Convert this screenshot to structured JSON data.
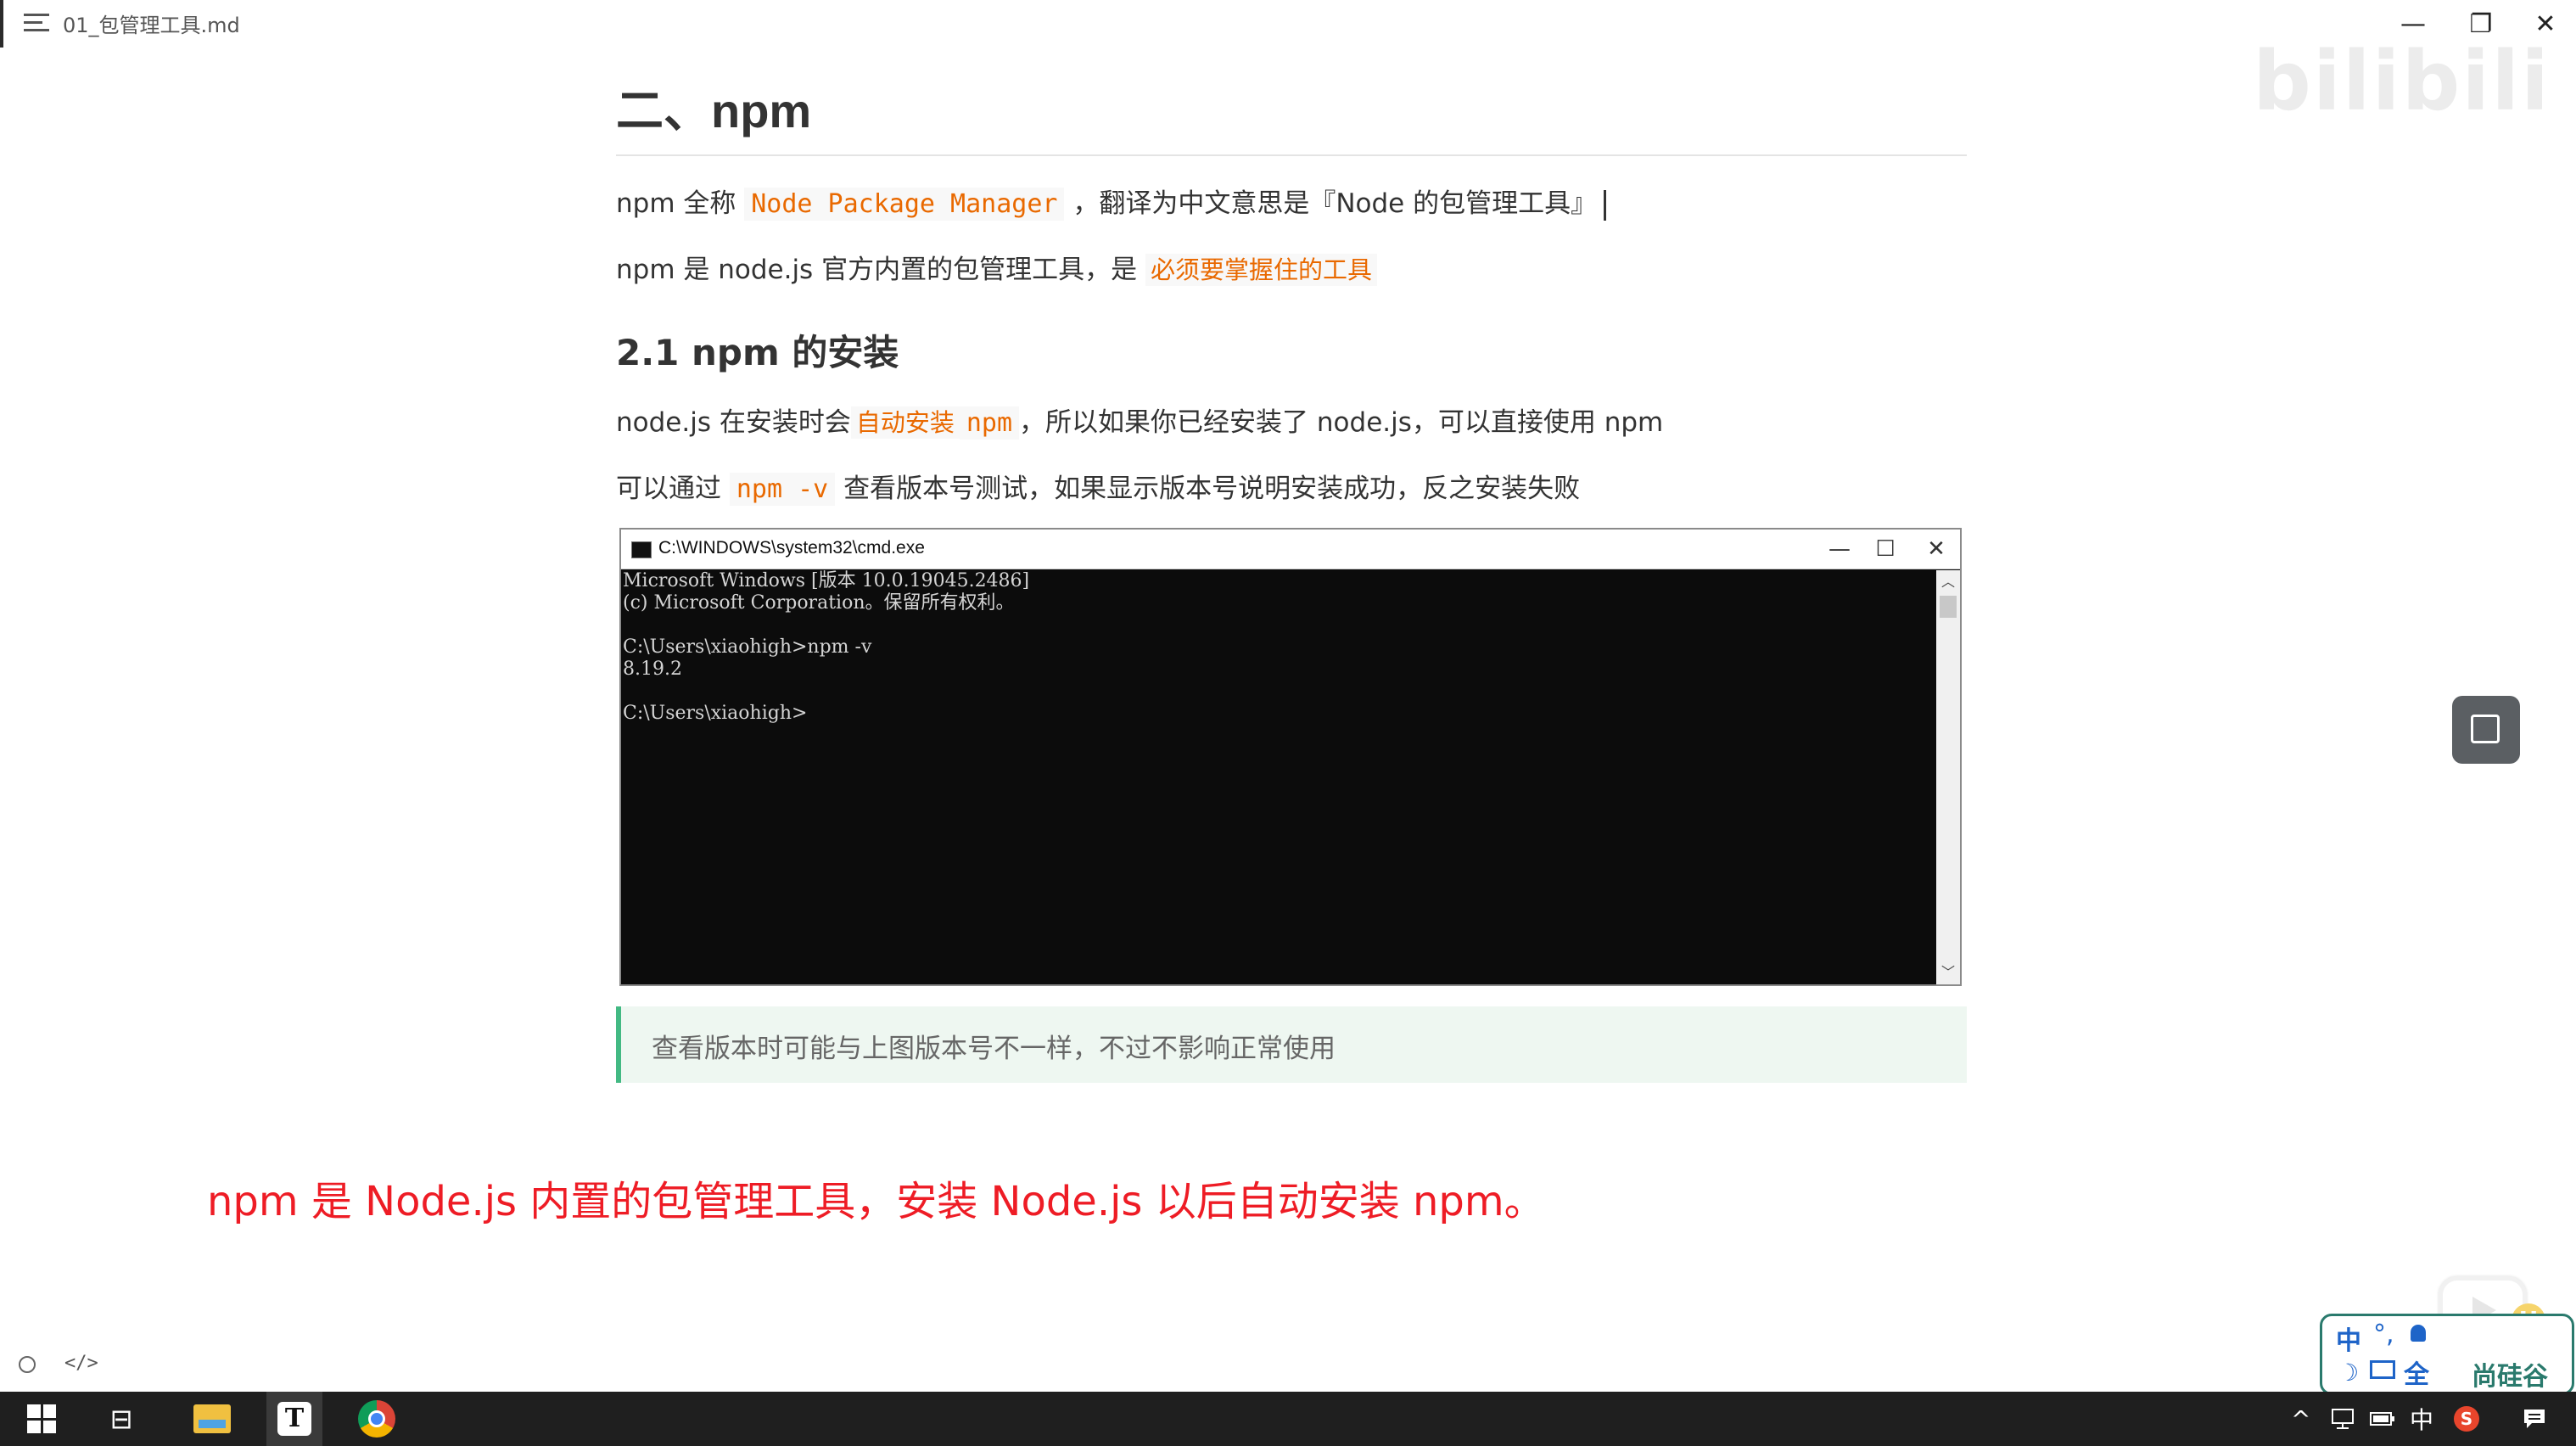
{
  "window": {
    "title": "01_包管理工具.md",
    "minimize": "—",
    "maximize": "❐",
    "close": "✕"
  },
  "watermark": {
    "text": "bilibili"
  },
  "doc": {
    "h2": "二、npm",
    "p1": {
      "a": "npm 全称",
      "code": "Node Package Manager",
      "b": "，翻译为中文意思是『Node 的包管理工具』"
    },
    "p2": {
      "a": "npm 是 node.js 官方内置的包管理工具，是",
      "hl": "必须要掌握住的工具"
    },
    "h3": "2.1 npm 的安装",
    "p3": {
      "a": "node.js 在安装时会",
      "hl": "自动安装",
      "code": "npm",
      "b": "，所以如果你已经安装了 node.js，可以直接使用 npm"
    },
    "p4": {
      "a": "可以通过",
      "code": "npm -v",
      "b": "查看版本号测试，如果显示版本号说明安装成功，反之安装失败"
    },
    "tip": "查看版本时可能与上图版本号不一样，不过不影响正常使用"
  },
  "cmd": {
    "title": "C:\\WINDOWS\\system32\\cmd.exe",
    "lines": [
      "Microsoft Windows [版本 10.0.19045.2486]",
      "(c) Microsoft Corporation。保留所有权利。",
      "",
      "C:\\Users\\xiaohigh>npm -v",
      "8.19.2",
      "",
      "C:\\Users\\xiaohigh>"
    ],
    "min": "—",
    "max": "☐",
    "close": "✕"
  },
  "note": "npm 是 Node.js 内置的包管理工具，安装 Node.js 以后自动安装 npm。",
  "status": {
    "code_toggle": "</>"
  },
  "ime": {
    "zh": "中",
    "punct": "°,",
    "full": "全",
    "brand": "尚硅谷"
  },
  "taskbar": {
    "taskview": "⊟",
    "tray_up": "^",
    "tray_lang": "中"
  },
  "colors": {
    "accent_code": "#e96900",
    "tip_border": "#42b983",
    "note_red": "#ee1c25"
  }
}
